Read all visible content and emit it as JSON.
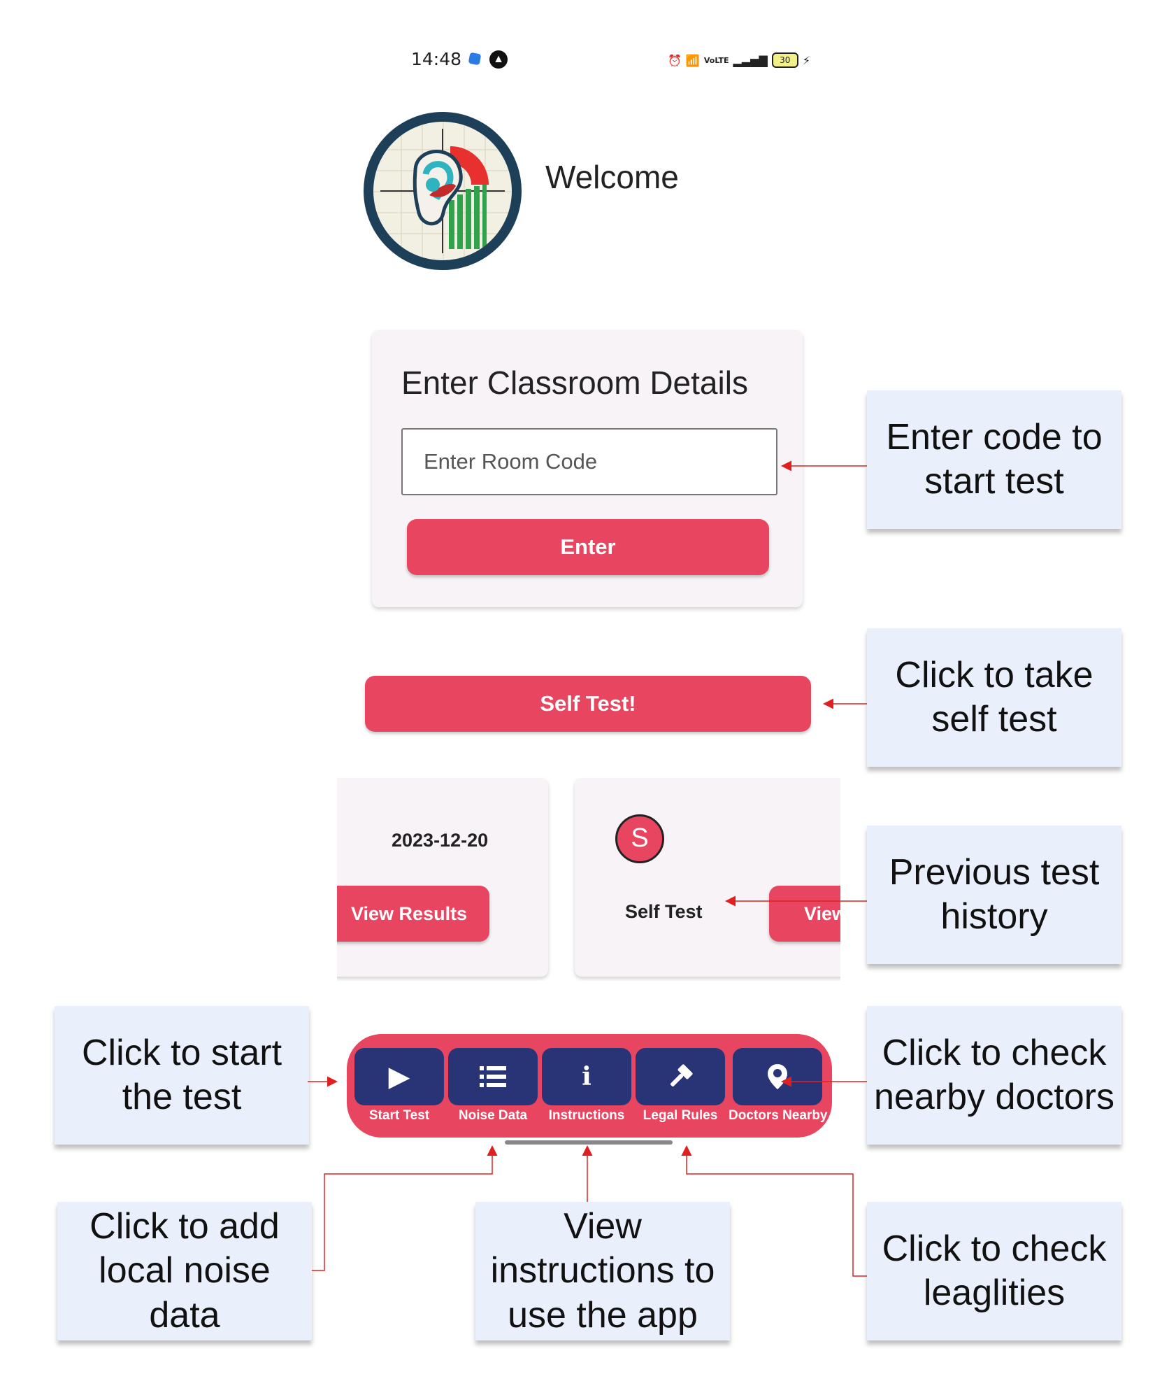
{
  "status_bar": {
    "time": "14:48",
    "battery": "30"
  },
  "header": {
    "welcome": "Welcome"
  },
  "classroom": {
    "title": "Enter Classroom Details",
    "room_code_placeholder": "Enter Room Code",
    "enter_label": "Enter"
  },
  "self_test_label": "Self Test!",
  "history": [
    {
      "date": "2023-12-20",
      "button": "View Results"
    },
    {
      "avatar_letter": "S",
      "label": "Self Test",
      "button": "View"
    }
  ],
  "nav": {
    "items": [
      {
        "label": "Start Test",
        "icon": "play-icon"
      },
      {
        "label": "Noise Data",
        "icon": "list-icon"
      },
      {
        "label": "Instructions",
        "icon": "info-icon"
      },
      {
        "label": "Legal Rules",
        "icon": "gavel-icon"
      },
      {
        "label": "Doctors Nearby",
        "icon": "location-pin-icon"
      }
    ]
  },
  "annotations": {
    "enter_code": "Enter code to start test",
    "self_test": "Click to take self test",
    "history": "Previous test history",
    "start_test": "Click to start the test",
    "doctors": "Click to check nearby doctors",
    "noise": "Click to add local noise data",
    "instructions": "View instructions to use the app",
    "legal": "Click to check leaglities"
  },
  "colors": {
    "accent_red": "#e84560",
    "nav_blue": "#283476",
    "annotation_bg": "#e9f0fb",
    "arrow_red": "#e02020"
  }
}
